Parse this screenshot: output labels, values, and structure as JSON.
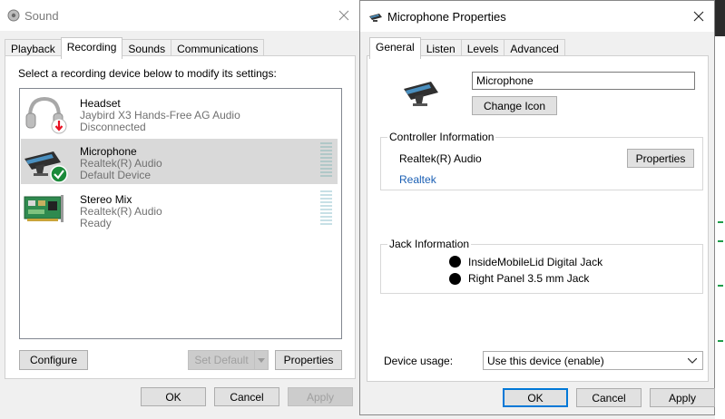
{
  "sound": {
    "title": "Sound",
    "tabs": [
      "Playback",
      "Recording",
      "Sounds",
      "Communications"
    ],
    "active_tab": "Recording",
    "instruction": "Select a recording device below to modify its settings:",
    "devices": [
      {
        "name": "Headset",
        "line1": "Jaybird X3 Hands-Free AG Audio",
        "line2": "Disconnected",
        "icon": "headset-icon",
        "status": "disconnected"
      },
      {
        "name": "Microphone",
        "line1": "Realtek(R) Audio",
        "line2": "Default Device",
        "icon": "microphone-icon",
        "status": "default",
        "selected": true
      },
      {
        "name": "Stereo Mix",
        "line1": "Realtek(R) Audio",
        "line2": "Ready",
        "icon": "sound-card-icon",
        "status": "ready"
      }
    ],
    "buttons": {
      "configure": "Configure",
      "set_default": "Set Default",
      "properties": "Properties",
      "ok": "OK",
      "cancel": "Cancel",
      "apply": "Apply"
    }
  },
  "props": {
    "title": "Microphone Properties",
    "tabs": [
      "General",
      "Listen",
      "Levels",
      "Advanced"
    ],
    "active_tab": "General",
    "device_name_value": "Microphone",
    "change_icon": "Change Icon",
    "controller": {
      "title": "Controller Information",
      "name": "Realtek(R) Audio",
      "properties_button": "Properties",
      "link": "Realtek"
    },
    "jack": {
      "title": "Jack Information",
      "items": [
        "InsideMobileLid Digital Jack",
        "Right Panel 3.5 mm Jack"
      ]
    },
    "device_usage_label": "Device usage:",
    "device_usage_value": "Use this device (enable)",
    "buttons": {
      "ok": "OK",
      "cancel": "Cancel",
      "apply": "Apply"
    }
  },
  "colors": {
    "accent": "#0078d7",
    "selection": "#d9d9d9",
    "link": "#1a5fb4",
    "check_green": "#107c10",
    "error_red": "#e81123"
  }
}
